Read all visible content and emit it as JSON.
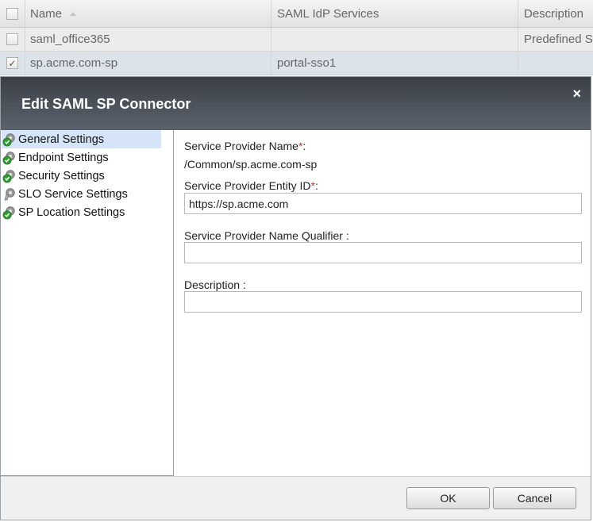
{
  "table": {
    "columns": [
      "Name",
      "SAML IdP Services",
      "Description"
    ],
    "rows": [
      {
        "checked": false,
        "name": "saml_office365",
        "idp": "",
        "description": "Predefined S"
      },
      {
        "checked": true,
        "name": "sp.acme.com-sp",
        "idp": "portal-sso1",
        "description": ""
      }
    ],
    "check_mark": "✓"
  },
  "dialog": {
    "title": "Edit SAML SP Connector",
    "close_glyph": "×",
    "nav": [
      {
        "label": "General Settings",
        "icon": "green-check-gear-icon",
        "selected": true
      },
      {
        "label": "Endpoint Settings",
        "icon": "green-check-gear-icon",
        "selected": false
      },
      {
        "label": "Security Settings",
        "icon": "green-check-gear-icon",
        "selected": false
      },
      {
        "label": "SLO Service Settings",
        "icon": "gear-icon",
        "selected": false
      },
      {
        "label": "SP Location Settings",
        "icon": "green-check-gear-icon",
        "selected": false
      }
    ],
    "form": {
      "sp_name_label": "Service Provider Name",
      "sp_name_value": "/Common/sp.acme.com-sp",
      "entity_id_label": "Service Provider Entity ID",
      "entity_id_value": "https://sp.acme.com",
      "name_qualifier_label": "Service Provider Name Qualifier",
      "name_qualifier_value": "",
      "description_label": "Description",
      "description_value": "",
      "required_mark": "*",
      "label_colon": ":",
      "spaced_colon": " :"
    },
    "buttons": {
      "ok": "OK",
      "cancel": "Cancel"
    }
  },
  "colors": {
    "title_bar": "#4d535c",
    "selected_nav": "#d6e4f7",
    "required": "#c0392b",
    "check_green": "#2e9e2e"
  }
}
